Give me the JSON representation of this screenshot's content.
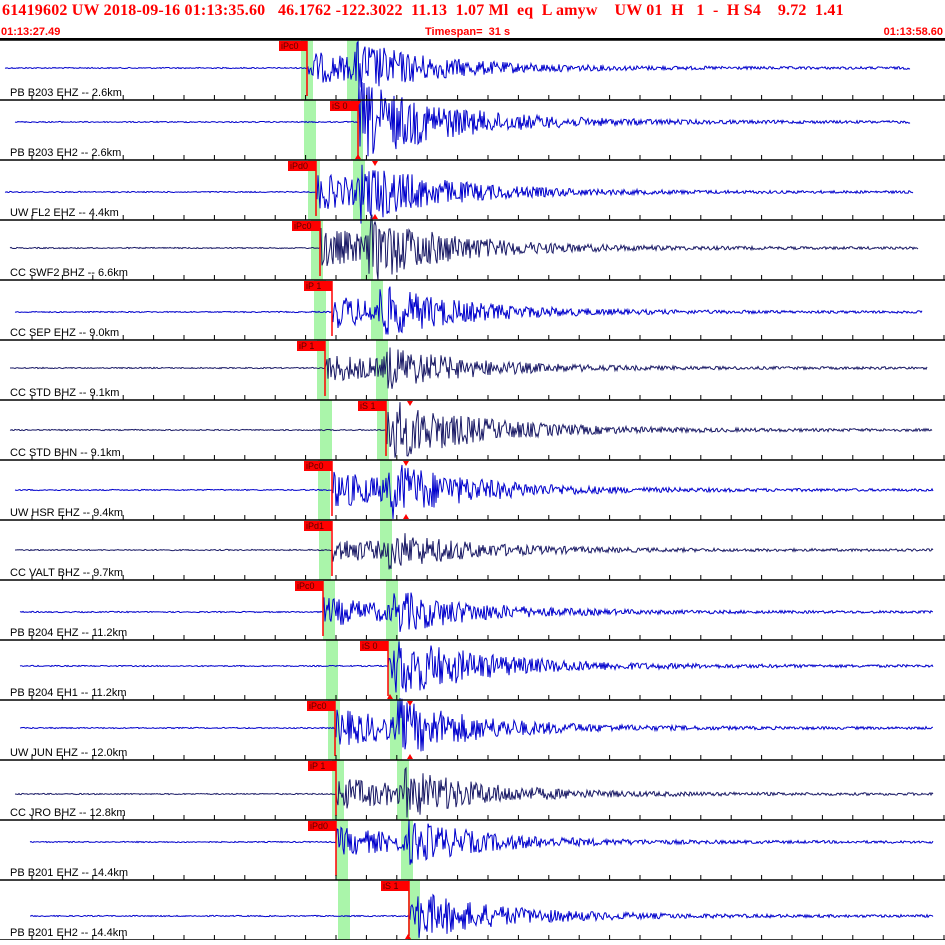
{
  "header": {
    "title": "61419602 UW 2018-09-16 01:13:35.60   46.1762 -122.3022  11.13  1.07 Ml  eq  L amyw    UW 01  H   1  -  H S4    9.72  1.41",
    "start_time": "01:13:27.49",
    "timespan": "Timespan=  31 s",
    "end_time": "01:13:58.60"
  },
  "colors": {
    "header_text": "#ff0000",
    "trace_blue": "#0000cc",
    "trace_dark": "#1a1a66",
    "pick_marker": "#ff0000",
    "band_green": "#aaf5aa"
  },
  "channels": [
    {
      "label": "PB B203 EHZ -- 2.6km",
      "pick": "iPc0",
      "color": "trace_blue"
    },
    {
      "label": "PB B203 EH2 -- 2.6km",
      "pick": "iS 0",
      "color": "trace_blue"
    },
    {
      "label": "UW FL2 EHZ -- 4.4km",
      "pick": "iPd0",
      "color": "trace_blue"
    },
    {
      "label": "CC SWF2 BHZ -- 6.6km",
      "pick": "iPc0",
      "color": "trace_dark"
    },
    {
      "label": "CC SEP EHZ -- 9.0km",
      "pick": "iP 1",
      "color": "trace_blue"
    },
    {
      "label": "CC STD BHZ -- 9.1km",
      "pick": "iP 1",
      "color": "trace_dark"
    },
    {
      "label": "CC STD BHN -- 9.1km",
      "pick": "iS 1",
      "color": "trace_dark"
    },
    {
      "label": "UW HSR EHZ -- 9.4km",
      "pick": "iPc0",
      "color": "trace_blue"
    },
    {
      "label": "CC VALT BHZ -- 9.7km",
      "pick": "iPd1",
      "color": "trace_dark"
    },
    {
      "label": "PB B204 EHZ -- 11.2km",
      "pick": "iPc0",
      "color": "trace_blue"
    },
    {
      "label": "PB B204 EH1 -- 11.2km",
      "pick": "iS 0",
      "color": "trace_blue"
    },
    {
      "label": "UW JUN EHZ -- 12.0km",
      "pick": "iPc0",
      "color": "trace_blue"
    },
    {
      "label": "CC JRO BHZ -- 12.8km",
      "pick": "iP 1",
      "color": "trace_dark"
    },
    {
      "label": "PB B201 EHZ -- 14.4km",
      "pick": "iPd0",
      "color": "trace_blue"
    },
    {
      "label": "PB B201 EH2 -- 14.4km",
      "pick": "iS 1",
      "color": "trace_blue"
    }
  ]
}
